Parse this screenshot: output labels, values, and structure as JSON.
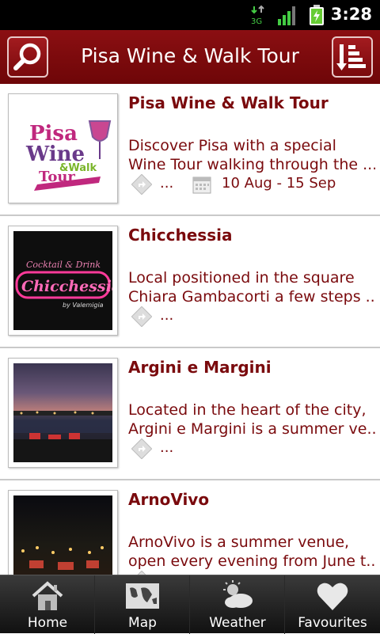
{
  "status_bar": {
    "time": "3:28",
    "network": "3G"
  },
  "header": {
    "title": "Pisa Wine & Walk Tour"
  },
  "items": [
    {
      "title": "Pisa Wine & Walk Tour",
      "desc_line1": " Discover Pisa with a special",
      "desc_line2": "Wine Tour walking through the ...",
      "more": "...",
      "dates": "10 Aug - 15 Sep",
      "logo_text": {
        "line1": "Pisa",
        "line2": "Wine",
        "line3": "&Walk",
        "line4": "Tour"
      }
    },
    {
      "title": "Chicchessia",
      "desc_line1": " Local positioned in the square",
      "desc_line2": "Chiara Gambacorti a few steps ...",
      "more": "...",
      "logo_text": {
        "top": "Cocktail & Drink",
        "main": "Chicchessia",
        "sub": "by Valemigia"
      }
    },
    {
      "title": "Argini e Margini",
      "desc_line1": " Located in the heart of the city,",
      "desc_line2": "Argini e Margini is a summer ve...",
      "more": "..."
    },
    {
      "title": "ArnoVivo",
      "desc_line1": " ArnoVivo is a summer venue,",
      "desc_line2": "open every evening from June t...",
      "more": "..."
    }
  ],
  "nav": [
    {
      "label": "Home",
      "icon": "home-icon"
    },
    {
      "label": "Map",
      "icon": "map-icon"
    },
    {
      "label": "Weather",
      "icon": "weather-icon"
    },
    {
      "label": "Favourites",
      "icon": "heart-icon"
    }
  ],
  "colors": {
    "accent": "#7a0a0d",
    "header_bg": "#7e0a0d",
    "nav_bg": "#222222"
  }
}
